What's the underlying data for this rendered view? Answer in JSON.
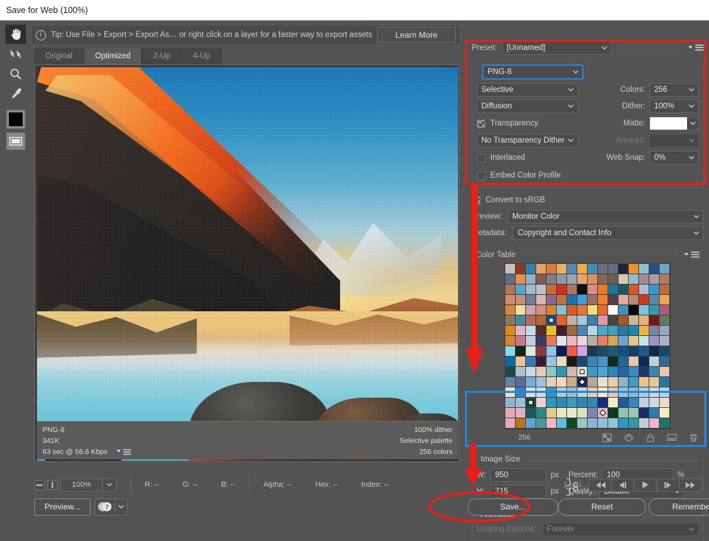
{
  "window": {
    "title": "Save for Web (100%)"
  },
  "tipbar": {
    "icon": "info-icon",
    "text": "Tip: Use File > Export > Export As…  or right click on a layer for a faster way to export assets",
    "learn_more": "Learn More"
  },
  "tools": [
    {
      "name": "hand-tool",
      "icon": "hand-icon",
      "active": true
    },
    {
      "name": "slice-select-tool",
      "icon": "slice-select-icon",
      "active": false
    },
    {
      "name": "zoom-tool",
      "icon": "magnifier-icon",
      "active": false
    },
    {
      "name": "eyedropper-tool",
      "icon": "eyedropper-icon",
      "active": false
    }
  ],
  "swatch": {
    "name": "eyedropper-color-swatch",
    "color": "#000000"
  },
  "slice_visibility": {
    "name": "toggle-slices-visibility",
    "icon": "slices-icon"
  },
  "tabs": [
    {
      "label": "Original",
      "active": false
    },
    {
      "label": "Optimized",
      "active": true
    },
    {
      "label": "2-Up",
      "active": false
    },
    {
      "label": "4-Up",
      "active": false
    }
  ],
  "preview_info": {
    "format": "PNG-8",
    "filesize": "341K",
    "download_time": "63 sec @ 56.6 Kbps",
    "dither": "100% dither",
    "palette": "Selective palette",
    "colors": "256 colors"
  },
  "settings": {
    "preset_label": "Preset:",
    "preset_value": "[Unnamed]",
    "format_value": "PNG-8",
    "reduction_value": "Selective",
    "dither_algorithm_value": "Diffusion",
    "transparency_label": "Transparency",
    "transparency_checked": true,
    "transparency_dither_value": "No Transparency Dither",
    "interlaced_label": "Interlaced",
    "interlaced_checked": false,
    "embed_profile_label": "Embed Color Profile",
    "embed_profile_checked": false,
    "colors_label": "Colors:",
    "colors_value": "256",
    "dither_label": "Dither:",
    "dither_value": "100%",
    "matte_label": "Matte:",
    "matte_color": "#ffffff",
    "amount_label": "Amount:",
    "amount_value": "",
    "websnap_label": "Web Snap:",
    "websnap_value": "0%"
  },
  "color_mgmt": {
    "convert_srgb_label": "Convert to sRGB",
    "convert_srgb_checked": true,
    "preview_label": "Preview:",
    "preview_value": "Monitor Color",
    "metadata_label": "Metadata:",
    "metadata_value": "Copyright and Contact Info"
  },
  "color_table": {
    "title": "Color Table",
    "count": "256",
    "actions": [
      {
        "name": "map-to-transparent-icon"
      },
      {
        "name": "shift-web-palette-icon"
      },
      {
        "name": "lock-color-icon"
      },
      {
        "name": "new-color-icon"
      },
      {
        "name": "delete-color-icon"
      }
    ],
    "swatches": [
      "#c9c3b6",
      "#8a3a26",
      "#2f82b4",
      "#e8a06b",
      "#dd7b3c",
      "#e6b457",
      "#5a86b4",
      "#f0ae3d",
      "#3d8ec0",
      "#6d6f79",
      "#5f6f86",
      "#20262b",
      "#ef9326",
      "#8cc3d8",
      "#27517f",
      "#6aa6cc",
      "#5a6f8f",
      "#e6904a",
      "#8fb2c4",
      "#8a5a4a",
      "#7b7f8a",
      "#8d98a6",
      "#93a6b6",
      "#e8a27a",
      "#e08f5c",
      "#8a6450",
      "#6f5f52",
      "#d6c7b4",
      "#8fc0d2",
      "#a08a93",
      "#b09a9c",
      "#b07a66",
      "#b07656",
      "#55a5cd",
      "#a8b9c6",
      "#b8c3cc",
      "#cf6a34",
      "#cc2f1f",
      "#a8775c",
      "#0d0f14",
      "#d98f88",
      "#ee7a21",
      "#1b7a98",
      "#1a5a62",
      "#e0541d",
      "#a9bcd2",
      "#2f9ad2",
      "#bf6a3c",
      "#cf8a6c",
      "#c98d72",
      "#6f7f90",
      "#d7b8ae",
      "#8a6a8c",
      "#c4703a",
      "#1875ac",
      "#3b9ed4",
      "#9e6a62",
      "#ea7e33",
      "#5a3a4a",
      "#e8a99a",
      "#b08a72",
      "#cf3a1b",
      "#5f86a2",
      "#eaa94c",
      "#d78a36",
      "#f0dfa0",
      "#c9a6b4",
      "#d2907e",
      "#d9842c",
      "#7fc3d8",
      "#de5a1c",
      "#e8723a",
      "#f0dd74",
      "#e26a2a",
      "#fdfdfd",
      "#3b92c6",
      "#050608",
      "#74c8dc",
      "#2f9ab0",
      "#b25a7a",
      "#8a7a63",
      "#4a8a95",
      "#b46a53",
      "#b06a3a",
      "#1b4f7f",
      "#e8622d",
      "#c2b09a",
      "#a9c6d6",
      "#3b7fb0",
      "#e494a9",
      "#3f4a3a",
      "#9e5a26",
      "#cdb496",
      "#e8b079",
      "#6a1f12",
      "#5f7a63",
      "#e08a1c",
      "#e8b4c3",
      "#bfe0ea",
      "#5a2a26",
      "#f0c020",
      "#3b1f2a",
      "#a06a3a",
      "#4a86b4",
      "#b9d4e6",
      "#3faec6",
      "#3b9fc6",
      "#2a7a9e",
      "#1b86b4",
      "#f0b437",
      "#7a82a6",
      "#97a6c6",
      "#d9842a",
      "#c97a86",
      "#c3cfe0",
      "#3b3a6a",
      "#e87a62",
      "#dde6ee",
      "#f0b8c6",
      "#f3d2de",
      "#b0b0a6",
      "#ea7a6a",
      "#d9a74a",
      "#6aa6d2",
      "#e8c48f",
      "#bfe6f0",
      "#9a96c6",
      "#a9b4c6",
      "#86dbe8",
      "#10291a",
      "#dfe6da",
      "#8a3a3a",
      "#8fc3ea",
      "#0b1a5a",
      "#ef5a4a",
      "#d2a6e0",
      "#1b3a4a",
      "#1a4a66",
      "#1f5a7a",
      "#17507a",
      "#0f4466",
      "#1b5a86",
      "#0d2a4a",
      "#16486b",
      "#0d6aa6",
      "#e8c49a",
      "#2f79b4",
      "#3a1a3a",
      "#9ac6da",
      "#e6dcc0",
      "#1b1a14",
      "#1b4a7a",
      "#3b86b4",
      "#4a96c6",
      "#0f2f1a",
      "#1b6a96",
      "#e8c6a6",
      "#0e2a52",
      "#b9d2e0",
      "#2f6a9a",
      "#1a4a42",
      "#a9c3d2",
      "#c3dce0",
      "#eac9b4",
      "#8fc6c6",
      "#2f96b4",
      "#cfbaa6",
      "#eae0d2",
      "#3b9ac6",
      "#4aa6d2",
      "#2f86b4",
      "#1f6a9a",
      "#3b8ac0",
      "#1f3a6a",
      "#3b86b0",
      "#e8c6b0",
      "#5f86a6",
      "#5f6a96",
      "#7aaed2",
      "#9ac6da",
      "#e8cdb4",
      "#f0d9c0",
      "#cfa98a",
      "#1b2a5a",
      "#b9a69a",
      "#eae0d2",
      "#e8cdb0",
      "#8fb4c6",
      "#3b9ac6",
      "#eac48a",
      "#e8c49a",
      "#1f7a9e",
      "#eae3d2",
      "#2f86c6",
      "#d9dfe6",
      "#cfdce6",
      "#2f9ac6",
      "#a9cfd2",
      "#9ebfc9",
      "#b9d9e0",
      "#e8cdb4",
      "#f3ecc6",
      "#eac6b4",
      "#9ac3da",
      "#8fb9d2",
      "#b0cfe0",
      "#cfd9e6",
      "#bfd2e0",
      "#8fb4cf",
      "#9ac0d2",
      "#104a42",
      "#f0cfd9",
      "#2f9ab4",
      "#2f8ab4",
      "#3b9ac0",
      "#2f86b0",
      "#2f8ab4",
      "#1b2a8a",
      "#f3eec0",
      "#1f5aa6",
      "#3b86c0",
      "#c3d2e0",
      "#cfd9e0",
      "#e6dcd2",
      "#e8a9b4",
      "#e8b0c3",
      "#1a5a5a",
      "#2f8a86",
      "#e0d28a",
      "#f0e6b4",
      "#e6ecc6",
      "#d9e6c0",
      "#7a86b4",
      "#e8b4c6",
      "#0f3a1a",
      "#8fc6a9",
      "#9ac6b4",
      "#1b2a6a",
      "#2f7ab4",
      "#f3f0c0",
      "#e8a9b9",
      "#b07a1c",
      "#5fa6d2",
      "#4a9a96",
      "#f0b9c3",
      "#5fc0d9",
      "#0f4a1a",
      "#9ac6c0",
      "#8fb4d2",
      "#8fc0d9",
      "#8fc6cf",
      "#2f9ac0",
      "#2f9aa6",
      "#bfd2cf",
      "#f0b4c6",
      "#1a7a6a"
    ],
    "marked_cells": [
      {
        "index": 84,
        "shape": "cross"
      },
      {
        "index": 167,
        "shape": "cross"
      },
      {
        "index": 183,
        "shape": "diamond"
      },
      {
        "index": 210,
        "shape": "cross"
      },
      {
        "index": 233,
        "shape": "diamond"
      }
    ]
  },
  "image_size": {
    "title": "Image Size",
    "w_label": "W:",
    "w_value": "950",
    "w_unit": "px",
    "h_label": "H:",
    "h_value": "715",
    "h_unit": "px",
    "link_icon": "chain-link-icon",
    "percent_label": "Percent:",
    "percent_value": "100",
    "percent_unit": "%",
    "quality_label": "Quality:",
    "quality_value": "Bicubic"
  },
  "animation": {
    "title": "Animation",
    "looping_label": "Looping Options:",
    "looping_value": "Forever"
  },
  "statusbar": {
    "zoom_value": "100%",
    "r_label": "R: --",
    "g_label": "G: --",
    "b_label": "B: --",
    "alpha_label": "Alpha: --",
    "hex_label": "Hex: --",
    "index_label": "Index: --",
    "frame_count": "1 of 1",
    "nav_buttons": [
      {
        "name": "first-frame-button",
        "glyph": "◀◀"
      },
      {
        "name": "previous-frame-button",
        "glyph": "◀|"
      },
      {
        "name": "play-button",
        "glyph": "▶"
      },
      {
        "name": "next-frame-button",
        "glyph": "|▶"
      },
      {
        "name": "last-frame-button",
        "glyph": "▶▶"
      }
    ]
  },
  "buttons": {
    "preview": "Preview...",
    "save": "Save...",
    "reset": "Reset",
    "remember": "Remember"
  },
  "annotations": {
    "red": "#e8201a",
    "blue": "#1f87e8"
  }
}
